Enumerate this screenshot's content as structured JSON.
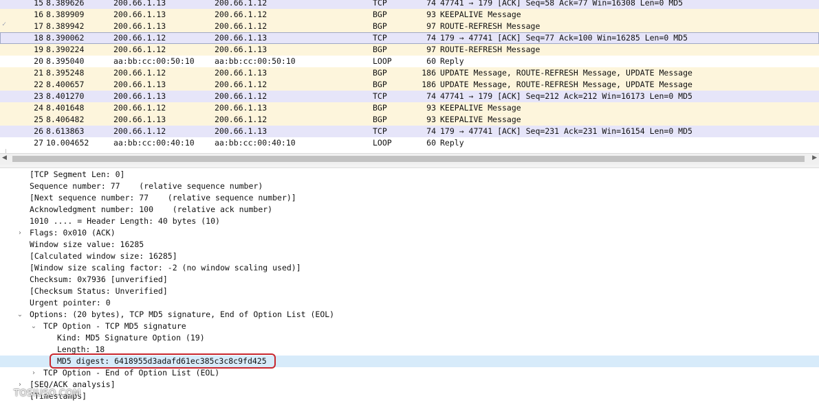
{
  "packet_list": {
    "rows": [
      {
        "no": "15",
        "time": "8.389626",
        "src": "200.66.1.13",
        "dst": "200.66.1.12",
        "proto": "TCP",
        "len": "74",
        "info": "47741 → 179 [ACK] Seq=58 Ack=77 Win=16308 Len=0 MD5",
        "kind": "tcp"
      },
      {
        "no": "16",
        "time": "8.389909",
        "src": "200.66.1.13",
        "dst": "200.66.1.12",
        "proto": "BGP",
        "len": "93",
        "info": "KEEPALIVE Message",
        "kind": "bgp"
      },
      {
        "no": "17",
        "time": "8.389942",
        "src": "200.66.1.13",
        "dst": "200.66.1.12",
        "proto": "BGP",
        "len": "97",
        "info": "ROUTE-REFRESH Message",
        "kind": "bgp"
      },
      {
        "no": "18",
        "time": "8.390062",
        "src": "200.66.1.12",
        "dst": "200.66.1.13",
        "proto": "TCP",
        "len": "74",
        "info": "179 → 47741 [ACK] Seq=77 Ack=100 Win=16285 Len=0 MD5",
        "kind": "tcp",
        "selected": true
      },
      {
        "no": "19",
        "time": "8.390224",
        "src": "200.66.1.12",
        "dst": "200.66.1.13",
        "proto": "BGP",
        "len": "97",
        "info": "ROUTE-REFRESH Message",
        "kind": "bgp"
      },
      {
        "no": "20",
        "time": "8.395040",
        "src": "aa:bb:cc:00:50:10",
        "dst": "aa:bb:cc:00:50:10",
        "proto": "LOOP",
        "len": "60",
        "info": "Reply",
        "kind": "loop"
      },
      {
        "no": "21",
        "time": "8.395248",
        "src": "200.66.1.12",
        "dst": "200.66.1.13",
        "proto": "BGP",
        "len": "186",
        "info": "UPDATE Message, ROUTE-REFRESH Message, UPDATE Message",
        "kind": "bgp"
      },
      {
        "no": "22",
        "time": "8.400657",
        "src": "200.66.1.13",
        "dst": "200.66.1.12",
        "proto": "BGP",
        "len": "186",
        "info": "UPDATE Message, ROUTE-REFRESH Message, UPDATE Message",
        "kind": "bgp"
      },
      {
        "no": "23",
        "time": "8.401270",
        "src": "200.66.1.13",
        "dst": "200.66.1.12",
        "proto": "TCP",
        "len": "74",
        "info": "47741 → 179 [ACK] Seq=212 Ack=212 Win=16173 Len=0 MD5",
        "kind": "tcp"
      },
      {
        "no": "24",
        "time": "8.401648",
        "src": "200.66.1.12",
        "dst": "200.66.1.13",
        "proto": "BGP",
        "len": "93",
        "info": "KEEPALIVE Message",
        "kind": "bgp"
      },
      {
        "no": "25",
        "time": "8.406482",
        "src": "200.66.1.13",
        "dst": "200.66.1.12",
        "proto": "BGP",
        "len": "93",
        "info": "KEEPALIVE Message",
        "kind": "bgp"
      },
      {
        "no": "26",
        "time": "8.613863",
        "src": "200.66.1.12",
        "dst": "200.66.1.13",
        "proto": "TCP",
        "len": "74",
        "info": "179 → 47741 [ACK] Seq=231 Ack=231 Win=16154 Len=0 MD5",
        "kind": "tcp"
      },
      {
        "no": "27",
        "time": "10.004652",
        "src": "aa:bb:cc:00:40:10",
        "dst": "aa:bb:cc:00:40:10",
        "proto": "LOOP",
        "len": "60",
        "info": "Reply",
        "kind": "loop"
      }
    ]
  },
  "details": {
    "rows": [
      {
        "level": 0,
        "toggle": "",
        "text": "[TCP Segment Len: 0]"
      },
      {
        "level": 0,
        "toggle": "",
        "text": "Sequence number: 77    (relative sequence number)"
      },
      {
        "level": 0,
        "toggle": "",
        "text": "[Next sequence number: 77    (relative sequence number)]"
      },
      {
        "level": 0,
        "toggle": "",
        "text": "Acknowledgment number: 100    (relative ack number)"
      },
      {
        "level": 0,
        "toggle": "",
        "text": "1010 .... = Header Length: 40 bytes (10)"
      },
      {
        "level": 0,
        "toggle": "›",
        "text": "Flags: 0x010 (ACK)"
      },
      {
        "level": 0,
        "toggle": "",
        "text": "Window size value: 16285"
      },
      {
        "level": 0,
        "toggle": "",
        "text": "[Calculated window size: 16285]"
      },
      {
        "level": 0,
        "toggle": "",
        "text": "[Window size scaling factor: -2 (no window scaling used)]"
      },
      {
        "level": 0,
        "toggle": "",
        "text": "Checksum: 0x7936 [unverified]"
      },
      {
        "level": 0,
        "toggle": "",
        "text": "[Checksum Status: Unverified]"
      },
      {
        "level": 0,
        "toggle": "",
        "text": "Urgent pointer: 0"
      },
      {
        "level": 0,
        "toggle": "⌄",
        "text": "Options: (20 bytes), TCP MD5 signature, End of Option List (EOL)"
      },
      {
        "level": 1,
        "toggle": "⌄",
        "text": "TCP Option - TCP MD5 signature"
      },
      {
        "level": 2,
        "toggle": "",
        "text": "Kind: MD5 Signature Option (19)"
      },
      {
        "level": 2,
        "toggle": "",
        "text": "Length: 18"
      },
      {
        "level": 2,
        "toggle": "",
        "text": "MD5 digest: 6418955d3adafd61ec385c3c8c9fd425",
        "highlight": true
      },
      {
        "level": 1,
        "toggle": "›",
        "text": "TCP Option - End of Option List (EOL)"
      },
      {
        "level": 0,
        "toggle": "›",
        "text": "[SEQ/ACK analysis]"
      },
      {
        "level": 0,
        "toggle": "",
        "text": "[Timestamps]"
      }
    ]
  },
  "watermark": "TOSIUSO.COM",
  "colors": {
    "bgp_row": "#fdf5dc",
    "tcp_row": "#e6e5f9",
    "highlight": "#d7ebfa",
    "annotation": "#c8262d"
  }
}
